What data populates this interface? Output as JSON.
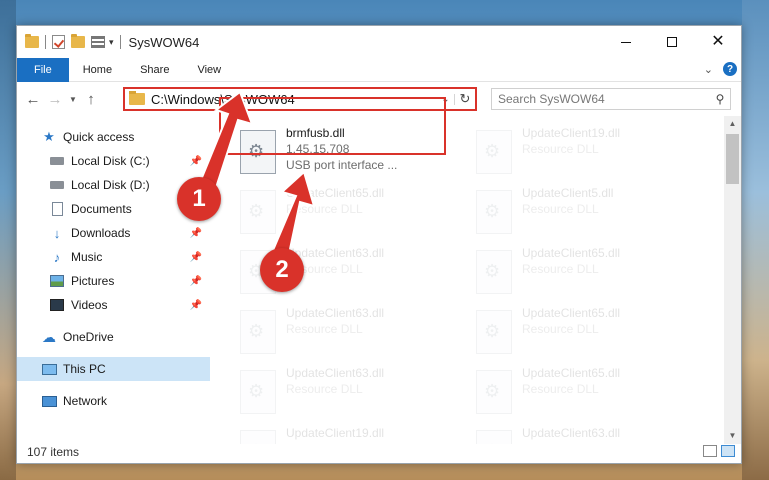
{
  "window": {
    "title": "SysWOW64"
  },
  "ribbon": {
    "tabs": [
      "File",
      "Home",
      "Share",
      "View"
    ],
    "accent": "#1a6fc2"
  },
  "address": {
    "path": "C:\\Windows\\SysWOW64"
  },
  "search": {
    "placeholder": "Search SysWOW64"
  },
  "sidebar": {
    "items": [
      {
        "label": "Quick access"
      },
      {
        "label": "Local Disk (C:)"
      },
      {
        "label": "Local Disk (D:)"
      },
      {
        "label": "Documents"
      },
      {
        "label": "Downloads"
      },
      {
        "label": "Music"
      },
      {
        "label": "Pictures"
      },
      {
        "label": "Videos"
      },
      {
        "label": "OneDrive"
      },
      {
        "label": "This PC"
      },
      {
        "label": "Network"
      }
    ]
  },
  "files": {
    "main": {
      "name": "brmfusb.dll",
      "version": "1.45.15.708",
      "desc": "USB port interface ..."
    },
    "faded": [
      {
        "name": "UpdateClient19.dll",
        "type": "Resource DLL"
      },
      {
        "name": "UpdateClient65.dll",
        "type": "Resource DLL"
      },
      {
        "name": "UpdateClient5.dll",
        "type": "Resource DLL"
      },
      {
        "name": "UpdateClient63.dll",
        "type": "Resource DLL"
      },
      {
        "name": "UpdateClient65.dll",
        "type": "Resource DLL"
      },
      {
        "name": "UpdateClient63.dll",
        "type": "Resource DLL"
      },
      {
        "name": "UpdateClient65.dll",
        "type": "Resource DLL"
      },
      {
        "name": "UpdateClient63.dll",
        "type": "Resource DLL"
      },
      {
        "name": "UpdateClient65.dll",
        "type": "Resource DLL"
      },
      {
        "name": "UpdateClient19.dll",
        "type": "Resource DLL"
      },
      {
        "name": "UpdateClient63.dll",
        "type": "Resource DLL"
      }
    ]
  },
  "status": {
    "count": "107 items"
  },
  "callouts": {
    "one": "1",
    "two": "2",
    "color": "#d9322a"
  }
}
